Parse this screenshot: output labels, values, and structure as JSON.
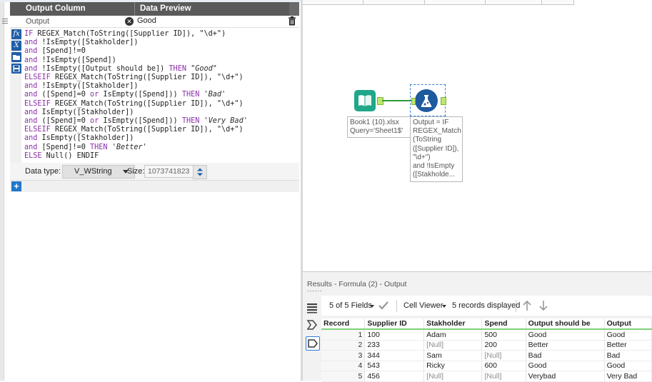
{
  "formula_panel": {
    "header": {
      "output_column": "Output Column",
      "data_preview": "Data Preview"
    },
    "row": {
      "output_value": "Output",
      "preview_value": "Good"
    },
    "expression_lines": [
      [
        {
          "t": "kw",
          "v": "IF "
        },
        {
          "t": "fn",
          "v": "REGEX_Match(ToString([Supplier ID]), \"\\d+\")"
        }
      ],
      [
        {
          "t": "kw",
          "v": "and "
        },
        {
          "t": "fn",
          "v": "!IsEmpty([Stakholder])"
        }
      ],
      [
        {
          "t": "kw",
          "v": "and "
        },
        {
          "t": "fn",
          "v": "[Spend]!=0"
        }
      ],
      [
        {
          "t": "kw",
          "v": "and "
        },
        {
          "t": "fn",
          "v": "!IsEmpty([Spend])"
        }
      ],
      [
        {
          "t": "kw",
          "v": "and "
        },
        {
          "t": "fn",
          "v": "!IsEmpty([Output should be]) "
        },
        {
          "t": "kw",
          "v": "THEN "
        },
        {
          "t": "str",
          "v": "\"Good\""
        }
      ],
      [
        {
          "t": "kw",
          "v": "ELSEIF "
        },
        {
          "t": "fn",
          "v": "REGEX_Match(ToString([Supplier ID]), \"\\d+\")"
        }
      ],
      [
        {
          "t": "kw",
          "v": "and "
        },
        {
          "t": "fn",
          "v": "!IsEmpty([Stakholder])"
        }
      ],
      [
        {
          "t": "kw",
          "v": "and "
        },
        {
          "t": "fn",
          "v": "([Spend]=0 "
        },
        {
          "t": "kw",
          "v": "or "
        },
        {
          "t": "fn",
          "v": "IsEmpty([Spend])) "
        },
        {
          "t": "kw",
          "v": "THEN "
        },
        {
          "t": "str",
          "v": "'Bad'"
        }
      ],
      [
        {
          "t": "kw",
          "v": "ELSEIF "
        },
        {
          "t": "fn",
          "v": "REGEX_Match(ToString([Supplier ID]), \"\\d+\")"
        }
      ],
      [
        {
          "t": "kw",
          "v": "and "
        },
        {
          "t": "fn",
          "v": "IsEmpty([Stakholder])"
        }
      ],
      [
        {
          "t": "kw",
          "v": "and "
        },
        {
          "t": "fn",
          "v": "([Spend]=0 "
        },
        {
          "t": "kw",
          "v": "or "
        },
        {
          "t": "fn",
          "v": "IsEmpty([Spend])) "
        },
        {
          "t": "kw",
          "v": "THEN "
        },
        {
          "t": "str",
          "v": "'Very Bad'"
        }
      ],
      [
        {
          "t": "kw",
          "v": "ELSEIF "
        },
        {
          "t": "fn",
          "v": "REGEX_Match(ToString([Supplier ID]), \"\\d+\")"
        }
      ],
      [
        {
          "t": "kw",
          "v": "and "
        },
        {
          "t": "fn",
          "v": "IsEmpty([Stakholder])"
        }
      ],
      [
        {
          "t": "kw",
          "v": "and "
        },
        {
          "t": "fn",
          "v": "[Spend]!=0 "
        },
        {
          "t": "kw",
          "v": "THEN "
        },
        {
          "t": "str",
          "v": "'Better'"
        }
      ],
      [
        {
          "t": "kw",
          "v": "ELSE "
        },
        {
          "t": "fn",
          "v": "Null() ENDIF"
        }
      ]
    ],
    "data_type_label": "Data type:",
    "data_type_value": "V_WString",
    "size_label": "Size:",
    "size_value": "1073741823",
    "add_symbol": "+"
  },
  "canvas": {
    "input_annotation": "Book1 (10).xlsx\nQuery='Sheet1$'",
    "formula_annotation": "Output = IF\nREGEX_Match\n(ToString\n([Supplier ID]),\n\"\\d+\")\nand !IsEmpty\n([Stakholde..."
  },
  "results": {
    "title": "Results - Formula (2) - Output",
    "fields_label": "5 of 5 Fields",
    "cell_viewer_label": "Cell Viewer",
    "records_label": "5 records displayed",
    "columns": [
      "Record",
      "Supplier ID",
      "Stakholder",
      "Spend",
      "Output should be",
      "Output"
    ],
    "rows": [
      [
        "1",
        "100",
        "Adam",
        "500",
        "Good",
        "Good"
      ],
      [
        "2",
        "233",
        "[Null]",
        "200",
        "Better",
        "Better"
      ],
      [
        "3",
        "344",
        "Sam",
        "[Null]",
        "Bad",
        "Bad"
      ],
      [
        "4",
        "543",
        "Ricky",
        "600",
        "Good",
        "Good"
      ],
      [
        "5",
        "456",
        "[Null]",
        "[Null]",
        "Verybad",
        "Very Bad"
      ]
    ]
  },
  "colors": {
    "header_bg": "#5a5a5a",
    "keyword": "#8b2fa8",
    "tool_input": "#20a78a",
    "tool_formula": "#1e5a9e",
    "connection": "#2d9b3a",
    "accent_blue": "#1f77c9"
  }
}
